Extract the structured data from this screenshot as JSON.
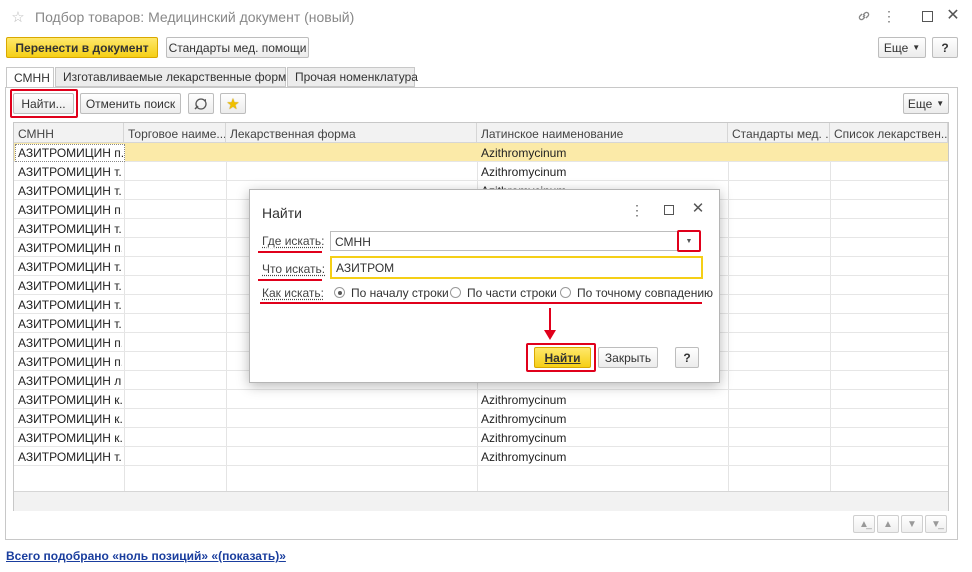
{
  "window": {
    "title": "Подбор товаров: Медицинский документ (новый)"
  },
  "toolbar": {
    "transfer_label": "Перенести в документ",
    "standards_label": "Стандарты мед. помощи",
    "more_label": "Еще",
    "help_label": "?"
  },
  "tabs": [
    {
      "label": "СМНН",
      "active": true
    },
    {
      "label": "Изготавливаемые лекарственные формы",
      "active": false
    },
    {
      "label": "Прочая номенклатура",
      "active": false
    }
  ],
  "list_toolbar": {
    "find_label": "Найти...",
    "cancel_search_label": "Отменить поиск",
    "more_label": "Еще"
  },
  "table": {
    "columns": [
      "СМНН",
      "Торговое наиме...",
      "Лекарственная форма",
      "Латинское наименование",
      "Стандарты мед. ...",
      "Список лекарствен..."
    ],
    "rows": [
      {
        "smnn": "АЗИТРОМИЦИН п...",
        "latin": "Azithromycinum",
        "selected": true
      },
      {
        "smnn": "АЗИТРОМИЦИН т...",
        "latin": "Azithromycinum"
      },
      {
        "smnn": "АЗИТРОМИЦИН т...",
        "latin": "Azithromycinum"
      },
      {
        "smnn": "АЗИТРОМИЦИН п...",
        "latin": ""
      },
      {
        "smnn": "АЗИТРОМИЦИН т...",
        "latin": ""
      },
      {
        "smnn": "АЗИТРОМИЦИН п...",
        "latin": ""
      },
      {
        "smnn": "АЗИТРОМИЦИН т...",
        "latin": ""
      },
      {
        "smnn": "АЗИТРОМИЦИН т...",
        "latin": ""
      },
      {
        "smnn": "АЗИТРОМИЦИН т...",
        "latin": ""
      },
      {
        "smnn": "АЗИТРОМИЦИН т...",
        "latin": ""
      },
      {
        "smnn": "АЗИТРОМИЦИН п...",
        "latin": ""
      },
      {
        "smnn": "АЗИТРОМИЦИН п...",
        "latin": ""
      },
      {
        "smnn": "АЗИТРОМИЦИН л...",
        "latin": ""
      },
      {
        "smnn": "АЗИТРОМИЦИН к...",
        "latin": "Azithromycinum"
      },
      {
        "smnn": "АЗИТРОМИЦИН к...",
        "latin": "Azithromycinum"
      },
      {
        "smnn": "АЗИТРОМИЦИН к...",
        "latin": "Azithromycinum"
      },
      {
        "smnn": "АЗИТРОМИЦИН т...",
        "latin": "Azithromycinum"
      }
    ]
  },
  "dialog": {
    "title": "Найти",
    "where_label": "Где искать:",
    "where_value": "СМНН",
    "what_label": "Что искать:",
    "what_value": "АЗИТРОМ",
    "how_label": "Как искать:",
    "how_options": [
      "По началу строки",
      "По части строки",
      "По точному совпадению"
    ],
    "how_selected": 0,
    "find_label": "Найти",
    "close_label": "Закрыть",
    "help_label": "?"
  },
  "footer": {
    "summary_link": "Всего подобрано «ноль позиций» «(показать)»"
  },
  "colors": {
    "accent_yellow": "#f5cf16",
    "annotation_red": "#e0001b",
    "selected_row": "#fbeaa8",
    "link_blue": "#1a3e9e"
  }
}
